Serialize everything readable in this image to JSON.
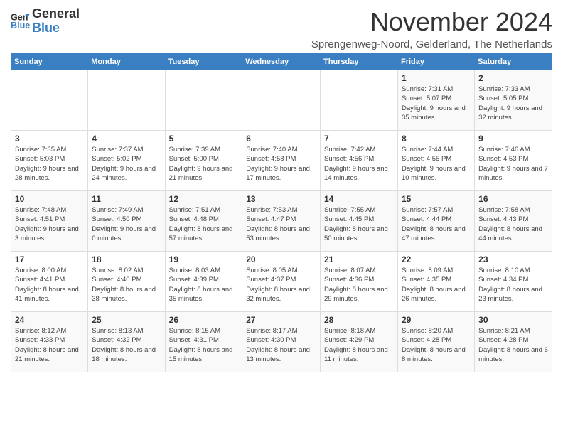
{
  "logo": {
    "line1": "General",
    "line2": "Blue"
  },
  "title": "November 2024",
  "location": "Sprengenweg-Noord, Gelderland, The Netherlands",
  "days_of_week": [
    "Sunday",
    "Monday",
    "Tuesday",
    "Wednesday",
    "Thursday",
    "Friday",
    "Saturday"
  ],
  "weeks": [
    [
      {
        "day": "",
        "sunrise": "",
        "sunset": "",
        "daylight": ""
      },
      {
        "day": "",
        "sunrise": "",
        "sunset": "",
        "daylight": ""
      },
      {
        "day": "",
        "sunrise": "",
        "sunset": "",
        "daylight": ""
      },
      {
        "day": "",
        "sunrise": "",
        "sunset": "",
        "daylight": ""
      },
      {
        "day": "",
        "sunrise": "",
        "sunset": "",
        "daylight": ""
      },
      {
        "day": "1",
        "sunrise": "Sunrise: 7:31 AM",
        "sunset": "Sunset: 5:07 PM",
        "daylight": "Daylight: 9 hours and 35 minutes."
      },
      {
        "day": "2",
        "sunrise": "Sunrise: 7:33 AM",
        "sunset": "Sunset: 5:05 PM",
        "daylight": "Daylight: 9 hours and 32 minutes."
      }
    ],
    [
      {
        "day": "3",
        "sunrise": "Sunrise: 7:35 AM",
        "sunset": "Sunset: 5:03 PM",
        "daylight": "Daylight: 9 hours and 28 minutes."
      },
      {
        "day": "4",
        "sunrise": "Sunrise: 7:37 AM",
        "sunset": "Sunset: 5:02 PM",
        "daylight": "Daylight: 9 hours and 24 minutes."
      },
      {
        "day": "5",
        "sunrise": "Sunrise: 7:39 AM",
        "sunset": "Sunset: 5:00 PM",
        "daylight": "Daylight: 9 hours and 21 minutes."
      },
      {
        "day": "6",
        "sunrise": "Sunrise: 7:40 AM",
        "sunset": "Sunset: 4:58 PM",
        "daylight": "Daylight: 9 hours and 17 minutes."
      },
      {
        "day": "7",
        "sunrise": "Sunrise: 7:42 AM",
        "sunset": "Sunset: 4:56 PM",
        "daylight": "Daylight: 9 hours and 14 minutes."
      },
      {
        "day": "8",
        "sunrise": "Sunrise: 7:44 AM",
        "sunset": "Sunset: 4:55 PM",
        "daylight": "Daylight: 9 hours and 10 minutes."
      },
      {
        "day": "9",
        "sunrise": "Sunrise: 7:46 AM",
        "sunset": "Sunset: 4:53 PM",
        "daylight": "Daylight: 9 hours and 7 minutes."
      }
    ],
    [
      {
        "day": "10",
        "sunrise": "Sunrise: 7:48 AM",
        "sunset": "Sunset: 4:51 PM",
        "daylight": "Daylight: 9 hours and 3 minutes."
      },
      {
        "day": "11",
        "sunrise": "Sunrise: 7:49 AM",
        "sunset": "Sunset: 4:50 PM",
        "daylight": "Daylight: 9 hours and 0 minutes."
      },
      {
        "day": "12",
        "sunrise": "Sunrise: 7:51 AM",
        "sunset": "Sunset: 4:48 PM",
        "daylight": "Daylight: 8 hours and 57 minutes."
      },
      {
        "day": "13",
        "sunrise": "Sunrise: 7:53 AM",
        "sunset": "Sunset: 4:47 PM",
        "daylight": "Daylight: 8 hours and 53 minutes."
      },
      {
        "day": "14",
        "sunrise": "Sunrise: 7:55 AM",
        "sunset": "Sunset: 4:45 PM",
        "daylight": "Daylight: 8 hours and 50 minutes."
      },
      {
        "day": "15",
        "sunrise": "Sunrise: 7:57 AM",
        "sunset": "Sunset: 4:44 PM",
        "daylight": "Daylight: 8 hours and 47 minutes."
      },
      {
        "day": "16",
        "sunrise": "Sunrise: 7:58 AM",
        "sunset": "Sunset: 4:43 PM",
        "daylight": "Daylight: 8 hours and 44 minutes."
      }
    ],
    [
      {
        "day": "17",
        "sunrise": "Sunrise: 8:00 AM",
        "sunset": "Sunset: 4:41 PM",
        "daylight": "Daylight: 8 hours and 41 minutes."
      },
      {
        "day": "18",
        "sunrise": "Sunrise: 8:02 AM",
        "sunset": "Sunset: 4:40 PM",
        "daylight": "Daylight: 8 hours and 38 minutes."
      },
      {
        "day": "19",
        "sunrise": "Sunrise: 8:03 AM",
        "sunset": "Sunset: 4:39 PM",
        "daylight": "Daylight: 8 hours and 35 minutes."
      },
      {
        "day": "20",
        "sunrise": "Sunrise: 8:05 AM",
        "sunset": "Sunset: 4:37 PM",
        "daylight": "Daylight: 8 hours and 32 minutes."
      },
      {
        "day": "21",
        "sunrise": "Sunrise: 8:07 AM",
        "sunset": "Sunset: 4:36 PM",
        "daylight": "Daylight: 8 hours and 29 minutes."
      },
      {
        "day": "22",
        "sunrise": "Sunrise: 8:09 AM",
        "sunset": "Sunset: 4:35 PM",
        "daylight": "Daylight: 8 hours and 26 minutes."
      },
      {
        "day": "23",
        "sunrise": "Sunrise: 8:10 AM",
        "sunset": "Sunset: 4:34 PM",
        "daylight": "Daylight: 8 hours and 23 minutes."
      }
    ],
    [
      {
        "day": "24",
        "sunrise": "Sunrise: 8:12 AM",
        "sunset": "Sunset: 4:33 PM",
        "daylight": "Daylight: 8 hours and 21 minutes."
      },
      {
        "day": "25",
        "sunrise": "Sunrise: 8:13 AM",
        "sunset": "Sunset: 4:32 PM",
        "daylight": "Daylight: 8 hours and 18 minutes."
      },
      {
        "day": "26",
        "sunrise": "Sunrise: 8:15 AM",
        "sunset": "Sunset: 4:31 PM",
        "daylight": "Daylight: 8 hours and 15 minutes."
      },
      {
        "day": "27",
        "sunrise": "Sunrise: 8:17 AM",
        "sunset": "Sunset: 4:30 PM",
        "daylight": "Daylight: 8 hours and 13 minutes."
      },
      {
        "day": "28",
        "sunrise": "Sunrise: 8:18 AM",
        "sunset": "Sunset: 4:29 PM",
        "daylight": "Daylight: 8 hours and 11 minutes."
      },
      {
        "day": "29",
        "sunrise": "Sunrise: 8:20 AM",
        "sunset": "Sunset: 4:28 PM",
        "daylight": "Daylight: 8 hours and 8 minutes."
      },
      {
        "day": "30",
        "sunrise": "Sunrise: 8:21 AM",
        "sunset": "Sunset: 4:28 PM",
        "daylight": "Daylight: 8 hours and 6 minutes."
      }
    ]
  ]
}
